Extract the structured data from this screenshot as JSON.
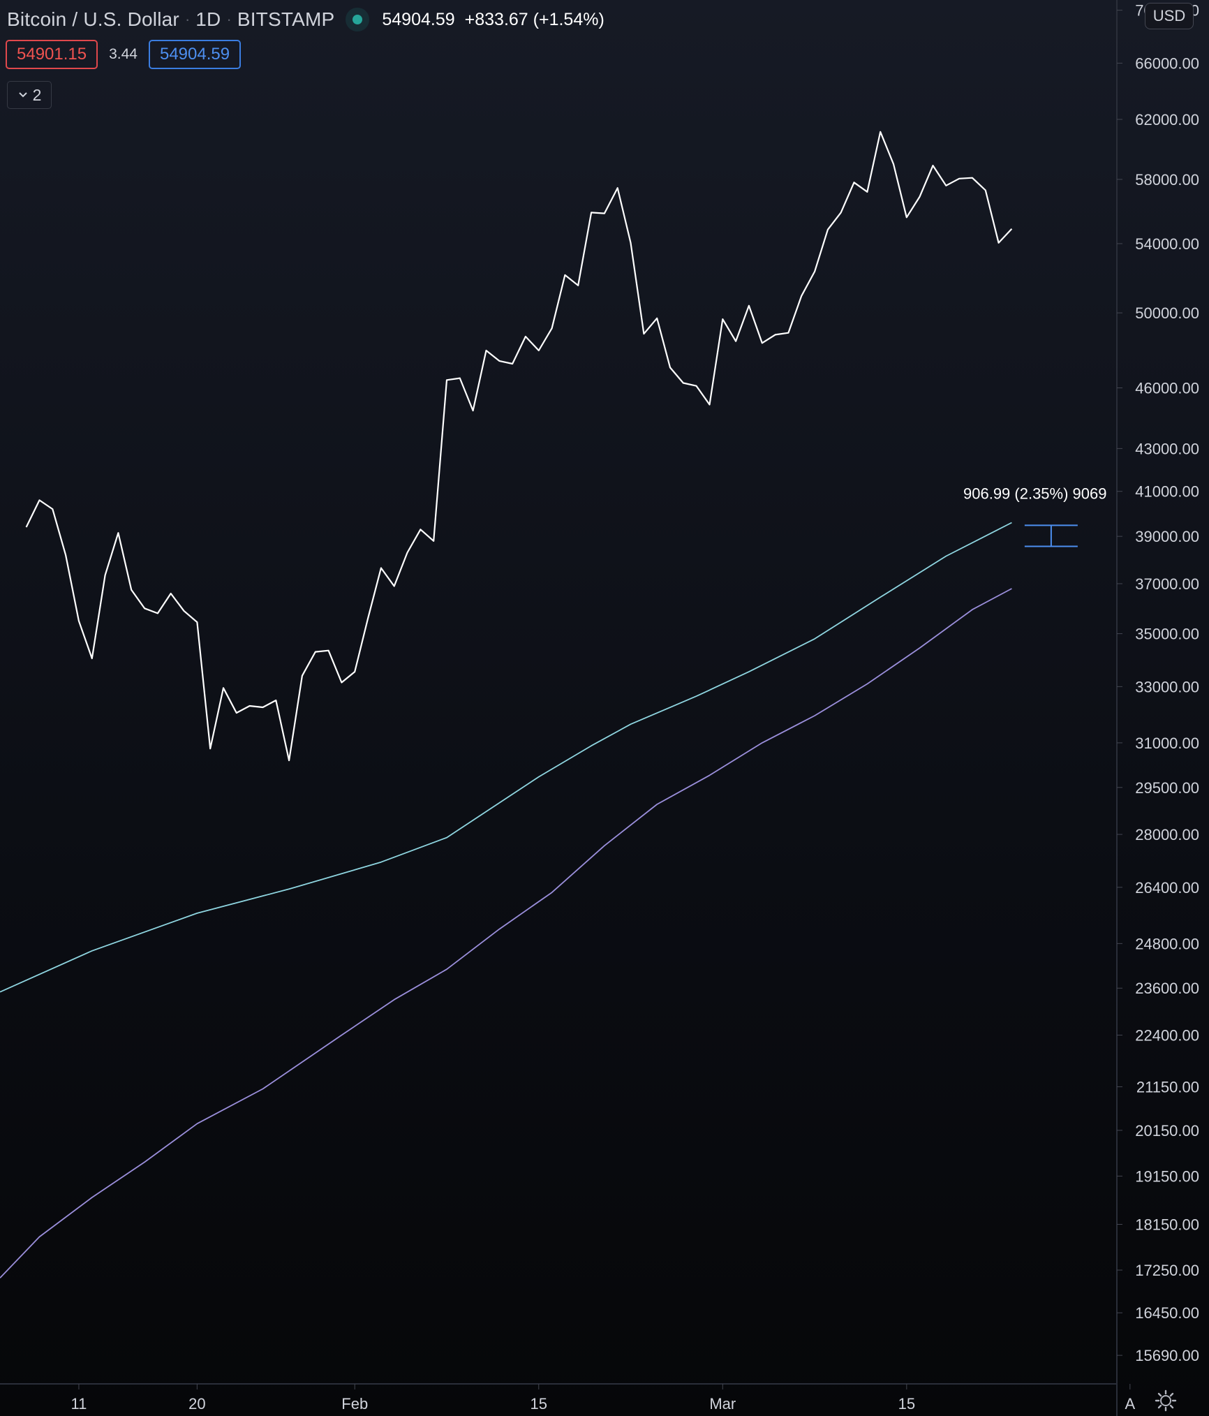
{
  "header": {
    "symbol": "Bitcoin / U.S. Dollar",
    "sep": "·",
    "interval": "1D",
    "exchange": "BITSTAMP",
    "last": "54904.59",
    "change": "+833.67 (+1.54%)"
  },
  "price_bar": {
    "bid": "54901.15",
    "spread": "3.44",
    "ask": "54904.59"
  },
  "indicators_toggle": {
    "label": "2"
  },
  "currency_button": "USD",
  "icons": {
    "collapse": "chevron-down-icon",
    "settings": "gear-icon",
    "status": "market-status-dot"
  },
  "colors": {
    "price": "#ffffff",
    "ma_fast": "#8fd6e1",
    "ma_slow": "#9b8fdc",
    "measure": "#4d8ff0",
    "grid_text": "#d1d4dc",
    "status": "#26a69a"
  },
  "chart_data": {
    "type": "line",
    "yscale": "log",
    "ylim": [
      15200,
      70800
    ],
    "xlim": [
      "2021-01-05",
      "2021-03-31"
    ],
    "y_ticks": [
      "70000.00",
      "66000.00",
      "62000.00",
      "58000.00",
      "54000.00",
      "50000.00",
      "46000.00",
      "43000.00",
      "41000.00",
      "39000.00",
      "37000.00",
      "35000.00",
      "33000.00",
      "31000.00",
      "29500.00",
      "28000.00",
      "26400.00",
      "24800.00",
      "23600.00",
      "22400.00",
      "21150.00",
      "20150.00",
      "19150.00",
      "18150.00",
      "17250.00",
      "16450.00",
      "15690.00"
    ],
    "x_ticks": [
      {
        "date": "2021-01-11",
        "label": "11"
      },
      {
        "date": "2021-01-20",
        "label": "20"
      },
      {
        "date": "2021-02-01",
        "label": "Feb"
      },
      {
        "date": "2021-02-15",
        "label": "15"
      },
      {
        "date": "2021-03-01",
        "label": "Mar"
      },
      {
        "date": "2021-03-15",
        "label": "15"
      },
      {
        "date": "2021-04-01",
        "label": "A"
      }
    ],
    "series": [
      {
        "key": "price",
        "dates": [
          "2021-01-07",
          "2021-01-08",
          "2021-01-09",
          "2021-01-10",
          "2021-01-11",
          "2021-01-12",
          "2021-01-13",
          "2021-01-14",
          "2021-01-15",
          "2021-01-16",
          "2021-01-17",
          "2021-01-18",
          "2021-01-19",
          "2021-01-20",
          "2021-01-21",
          "2021-01-22",
          "2021-01-23",
          "2021-01-24",
          "2021-01-25",
          "2021-01-26",
          "2021-01-27",
          "2021-01-28",
          "2021-01-29",
          "2021-01-30",
          "2021-01-31",
          "2021-02-01",
          "2021-02-02",
          "2021-02-03",
          "2021-02-04",
          "2021-02-05",
          "2021-02-06",
          "2021-02-07",
          "2021-02-08",
          "2021-02-09",
          "2021-02-10",
          "2021-02-11",
          "2021-02-12",
          "2021-02-13",
          "2021-02-14",
          "2021-02-15",
          "2021-02-16",
          "2021-02-17",
          "2021-02-18",
          "2021-02-19",
          "2021-02-20",
          "2021-02-21",
          "2021-02-22",
          "2021-02-23",
          "2021-02-24",
          "2021-02-25",
          "2021-02-26",
          "2021-02-27",
          "2021-02-28",
          "2021-03-01",
          "2021-03-02",
          "2021-03-03",
          "2021-03-04",
          "2021-03-05",
          "2021-03-06",
          "2021-03-07",
          "2021-03-08",
          "2021-03-09",
          "2021-03-10",
          "2021-03-11",
          "2021-03-12",
          "2021-03-13",
          "2021-03-14",
          "2021-03-15",
          "2021-03-16",
          "2021-03-17",
          "2021-03-18",
          "2021-03-19",
          "2021-03-20",
          "2021-03-21",
          "2021-03-22",
          "2021-03-23"
        ],
        "values": [
          39400,
          40600,
          40200,
          38200,
          35500,
          34050,
          37350,
          39150,
          36750,
          36000,
          35800,
          36600,
          35900,
          35450,
          30800,
          32950,
          32050,
          32300,
          32250,
          32500,
          30400,
          33400,
          34300,
          34350,
          33150,
          33550,
          35600,
          37650,
          36900,
          38300,
          39300,
          38800,
          46400,
          46500,
          44850,
          47950,
          47400,
          47250,
          48700,
          47950,
          49150,
          52150,
          51550,
          55900,
          55850,
          57450,
          54050,
          48850,
          49700,
          47050,
          46250,
          46100,
          45150,
          49650,
          48450,
          50400,
          48350,
          48800,
          48900,
          50950,
          52350,
          54850,
          55900,
          57800,
          57200,
          61150,
          59000,
          55600,
          56900,
          58900,
          57600,
          58050,
          58100,
          57300,
          54050,
          54900
        ]
      },
      {
        "key": "ma_fast",
        "dates": [
          "2021-01-05",
          "2021-01-12",
          "2021-01-20",
          "2021-01-27",
          "2021-02-03",
          "2021-02-08",
          "2021-02-15",
          "2021-02-19",
          "2021-02-22",
          "2021-02-27",
          "2021-03-03",
          "2021-03-08",
          "2021-03-13",
          "2021-03-18",
          "2021-03-23"
        ],
        "values": [
          23500,
          24600,
          25650,
          26350,
          27150,
          27900,
          29850,
          30900,
          31650,
          32650,
          33550,
          34800,
          36450,
          38150,
          39600
        ]
      },
      {
        "key": "ma_slow",
        "dates": [
          "2021-01-05",
          "2021-01-08",
          "2021-01-12",
          "2021-01-16",
          "2021-01-20",
          "2021-01-25",
          "2021-01-31",
          "2021-02-04",
          "2021-02-08",
          "2021-02-12",
          "2021-02-16",
          "2021-02-20",
          "2021-02-24",
          "2021-02-28",
          "2021-03-04",
          "2021-03-08",
          "2021-03-12",
          "2021-03-16",
          "2021-03-20",
          "2021-03-23"
        ],
        "values": [
          17100,
          17900,
          18700,
          19450,
          20300,
          21100,
          22400,
          23300,
          24100,
          25200,
          26250,
          27650,
          28950,
          29900,
          31000,
          31950,
          33100,
          34450,
          35950,
          36800
        ]
      }
    ],
    "measure": {
      "label": "906.99 (2.35%) 9069",
      "from": 38570,
      "to": 39480,
      "at": "2021-03-26"
    }
  }
}
